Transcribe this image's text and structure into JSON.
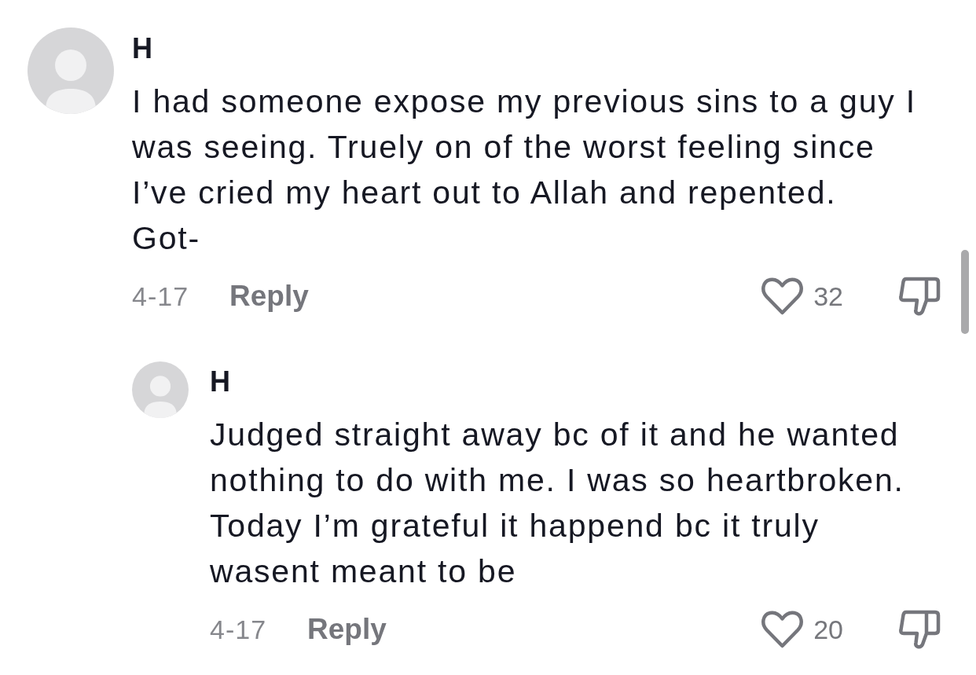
{
  "comments": [
    {
      "author": "H",
      "text": "I had someone expose my previous sins to a guy I\nwas seeing. Truely on of the worst feeling since\nI’ve cried my heart out to Allah and repented.\nGot-",
      "date": "4-17",
      "reply_label": "Reply",
      "likes": "32",
      "liked": false,
      "disliked": false,
      "replies": [
        {
          "author": "H",
          "text": "Judged straight away bc of it and he wanted\nnothing to do with me. I was so heartbroken.\nToday I’m grateful it happend bc it truly\nwasent meant to be",
          "date": "4-17",
          "reply_label": "Reply",
          "likes": "20",
          "liked": false,
          "disliked": false
        }
      ]
    }
  ]
}
